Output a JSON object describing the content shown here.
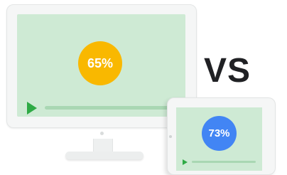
{
  "desktop": {
    "percent_label": "65%",
    "accent_color": "#f9b800",
    "play_icon": "play-icon"
  },
  "comparison": {
    "label": "VS"
  },
  "tablet": {
    "percent_label": "73%",
    "accent_color": "#4285f4",
    "play_icon": "play-icon"
  },
  "colors": {
    "screen": "#ceead4",
    "progress_track": "#a9d7b3",
    "play": "#2eaa45",
    "text_dark": "#202124"
  }
}
